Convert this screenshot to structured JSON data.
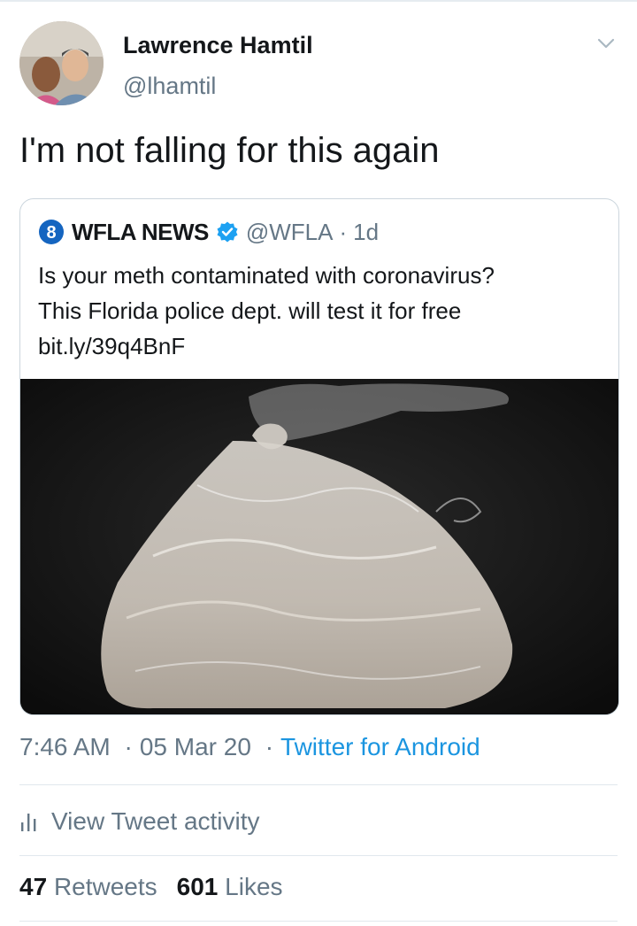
{
  "author": {
    "name": "Lawrence Hamtil",
    "handle": "@lhamtil"
  },
  "tweet": {
    "text": "I'm not falling for this again"
  },
  "quoted": {
    "logo_text": "8",
    "name": "WFLA NEWS",
    "handle": "@WFLA",
    "separator": "·",
    "age": "1d",
    "lines": [
      "Is your meth contaminated with coronavirus?",
      "This Florida police dept. will test it for free",
      "bit.ly/39q4BnF"
    ]
  },
  "meta": {
    "time": "7:46 AM",
    "sep1": "·",
    "date": "05 Mar 20",
    "sep2": "·",
    "source": "Twitter for Android"
  },
  "activity": {
    "label": "View Tweet activity"
  },
  "stats": {
    "retweets_count": "47",
    "retweets_label": "Retweets",
    "likes_count": "601",
    "likes_label": "Likes"
  },
  "icons": {
    "chevron": "chevron-down-icon",
    "verified": "verified-badge-icon",
    "activity": "bar-chart-icon",
    "logo": "wfla-8-logo"
  },
  "colors": {
    "link": "#1b95e0",
    "secondary": "#657786",
    "text": "#14171a",
    "border": "#ccd6dd",
    "verified": "#1da1f2"
  }
}
